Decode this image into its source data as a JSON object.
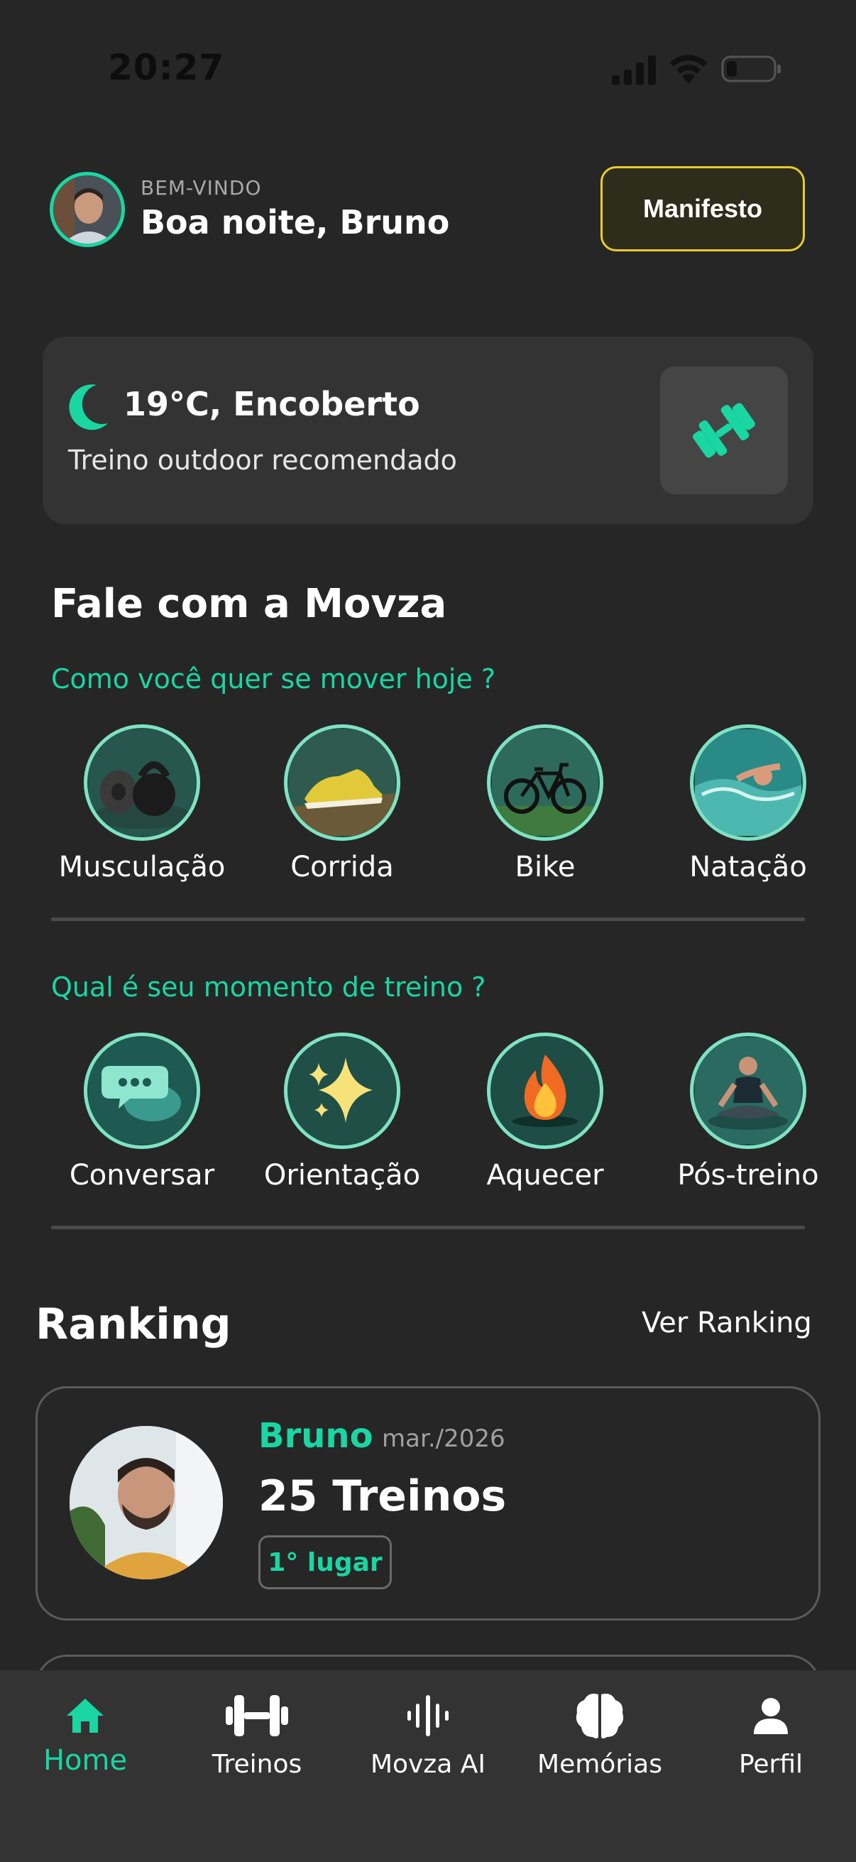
{
  "status_bar": {
    "time": "20:27"
  },
  "header": {
    "welcome_label": "BEM-VINDO",
    "greeting": "Boa noite, Bruno",
    "manifesto_label": "Manifesto"
  },
  "weather": {
    "temperature_text": "19°C, Encoberto",
    "recommendation": "Treino outdoor recomendado",
    "icon": "moon-icon",
    "action_icon": "dumbbell-icon"
  },
  "movza": {
    "title": "Fale com a Movza",
    "activity_question": "Como você quer se mover hoje ?",
    "activities": [
      {
        "label": "Musculação",
        "icon": "kettlebell-icon"
      },
      {
        "label": "Corrida",
        "icon": "sneaker-icon"
      },
      {
        "label": "Bike",
        "icon": "bicycle-icon"
      },
      {
        "label": "Natação",
        "icon": "swimmer-icon"
      }
    ],
    "moment_question": "Qual é seu momento de treino ?",
    "moments": [
      {
        "label": "Conversar",
        "icon": "chat-bubble-icon"
      },
      {
        "label": "Orientação",
        "icon": "sparkles-icon"
      },
      {
        "label": "Aquecer",
        "icon": "flame-icon"
      },
      {
        "label": "Pós-treino",
        "icon": "meditation-icon"
      }
    ]
  },
  "ranking": {
    "title": "Ranking",
    "link_label": "Ver Ranking",
    "entries": [
      {
        "name": "Bruno",
        "month": "mar./2026",
        "count_text": "25 Treinos",
        "place": "1° lugar"
      }
    ]
  },
  "bottom_nav": {
    "items": [
      {
        "label": "Home",
        "icon": "home-icon",
        "active": true
      },
      {
        "label": "Treinos",
        "icon": "dumbbell-icon",
        "active": false
      },
      {
        "label": "Movza AI",
        "icon": "waveform-icon",
        "active": false
      },
      {
        "label": "Memórias",
        "icon": "brain-icon",
        "active": false
      },
      {
        "label": "Perfil",
        "icon": "person-icon",
        "active": false
      }
    ]
  },
  "colors": {
    "accent": "#19d6a3",
    "background": "#262626",
    "card": "#333333",
    "manifesto_border": "#e7cc2c"
  }
}
